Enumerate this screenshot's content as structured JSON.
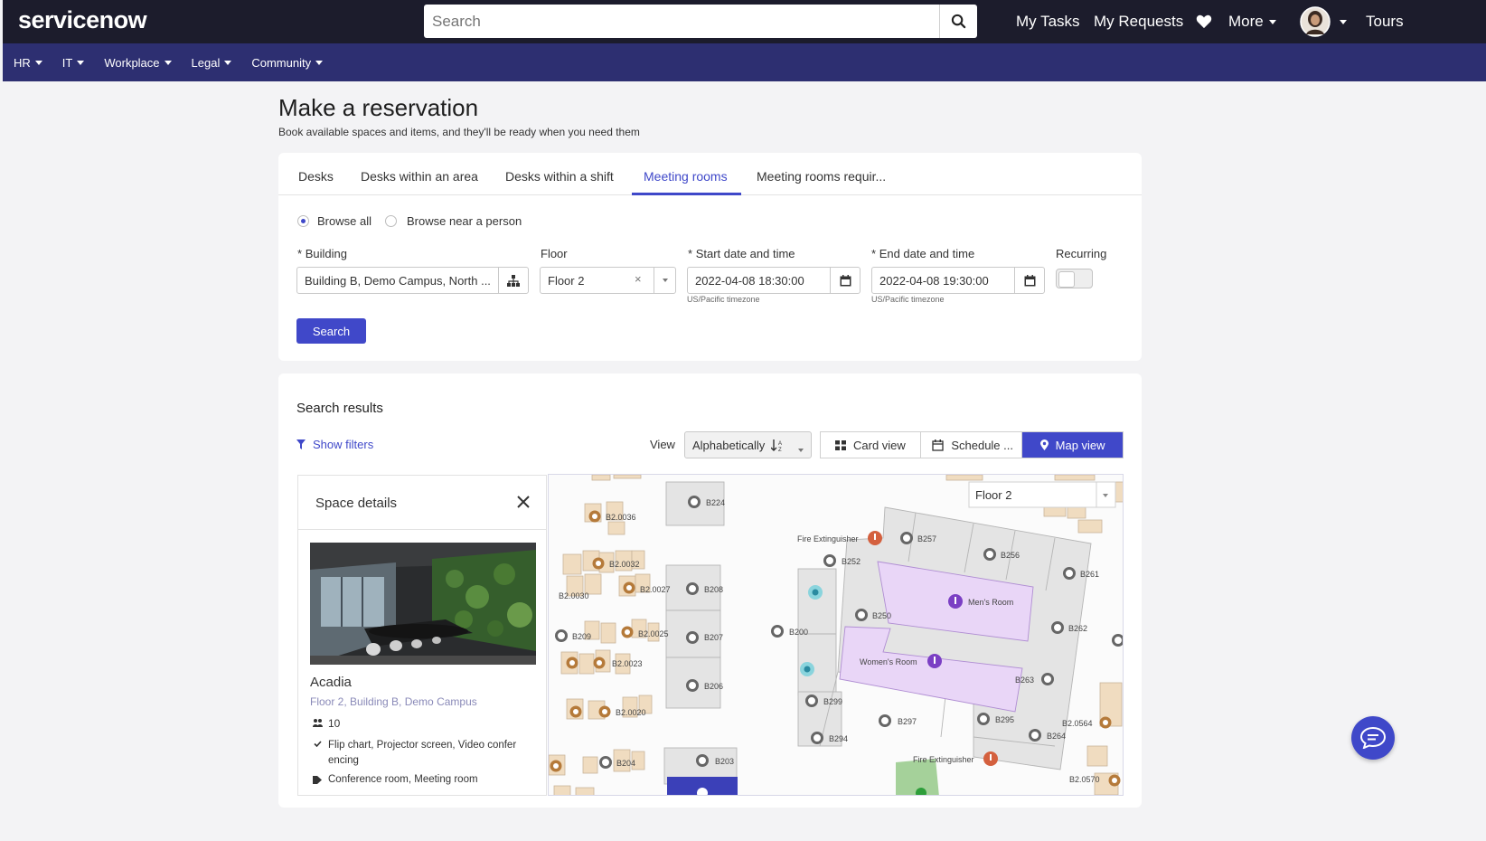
{
  "header": {
    "logo": "servicenow",
    "search_placeholder": "Search",
    "nav": {
      "my_tasks": "My Tasks",
      "my_requests": "My Requests",
      "more": "More",
      "tours": "Tours"
    }
  },
  "subnav": [
    "HR",
    "IT",
    "Workplace",
    "Legal",
    "Community"
  ],
  "page": {
    "title": "Make a reservation",
    "subtitle": "Book available spaces and items, and they'll be ready when you need them"
  },
  "tabs": [
    "Desks",
    "Desks within an area",
    "Desks within a shift",
    "Meeting rooms",
    "Meeting rooms requir..."
  ],
  "active_tab": "Meeting rooms",
  "browse": {
    "all": "Browse all",
    "near": "Browse near a person",
    "selected": "Browse all"
  },
  "form": {
    "building_label": "Building",
    "building_value": "Building B, Demo Campus, North ...",
    "floor_label": "Floor",
    "floor_value": "Floor 2",
    "start_label": "Start date and time",
    "start_value": "2022-04-08 18:30:00",
    "end_label": "End date and time",
    "end_value": "2022-04-08 19:30:00",
    "timezone": "US/Pacific timezone",
    "recurring_label": "Recurring",
    "recurring_on": false,
    "required_mark": "*",
    "search_button": "Search"
  },
  "results": {
    "title": "Search results",
    "show_filters": "Show filters",
    "view_label": "View",
    "sort_value": "Alphabetically",
    "card_view": "Card view",
    "schedule_view": "Schedule ...",
    "map_view": "Map view",
    "active_view": "Map view"
  },
  "space_details": {
    "title": "Space details",
    "name": "Acadia",
    "location": "Floor 2, Building B, Demo Campus",
    "capacity": "10",
    "equipment_line1": "Flip chart, Projector screen, Video confer",
    "equipment_line2": "encing",
    "type": "Conference room, Meeting room"
  },
  "map": {
    "floor_select": "Floor 2",
    "labels": {
      "b224": "B224",
      "b20036": "B2.0036",
      "b20032": "B2.0032",
      "b20030": "B2.0030",
      "b20027": "B2.0027",
      "b208": "B208",
      "b209": "B209",
      "b20025": "B2.0025",
      "b207": "B207",
      "b20023": "B2.0023",
      "b206": "B206",
      "b20020": "B2.0020",
      "b204": "B204",
      "b203": "B203",
      "b257": "B257",
      "b256": "B256",
      "b252": "B252",
      "b261": "B261",
      "b250": "B250",
      "b200": "B200",
      "b262": "B262",
      "b263": "B263",
      "b299": "B299",
      "b297": "B297",
      "b295": "B295",
      "b294": "B294",
      "b264": "B264",
      "b20564": "B2.0564",
      "b20570": "B2.0570",
      "fire1": "Fire Extinguisher",
      "fire2": "Fire Extinguisher",
      "mens": "Men's Room",
      "womens": "Women's Room"
    }
  },
  "colors": {
    "header_bg": "#1c1c2c",
    "subnav_bg": "#2d2f71",
    "accent": "#4048c9",
    "restroom_fill": "#e9d6f7",
    "restroom_pin": "#7b3fc4",
    "fire_pin": "#d4603e",
    "desk_fill": "#f0dcc0",
    "desk_pin": "#b57a3a",
    "room_fill": "#e4e4e4"
  }
}
